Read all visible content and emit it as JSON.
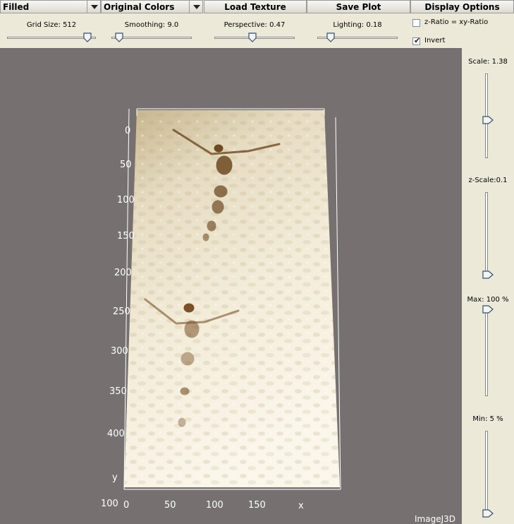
{
  "toolbar": {
    "render_mode": "Filled",
    "color_mode": "Original Colors",
    "load_texture": "Load Texture",
    "save_plot": "Save Plot",
    "display_options": "Display Options"
  },
  "sliders": {
    "grid_size": {
      "label": "Grid Size: 512",
      "level": 0.95
    },
    "smoothing": {
      "label": "Smoothing: 9.0",
      "level": 0.05
    },
    "perspective": {
      "label": "Perspective: 0.47",
      "level": 0.47
    },
    "lighting": {
      "label": "Lighting: 0.18",
      "level": 0.13
    }
  },
  "checkboxes": {
    "z_ratio": {
      "label": "z-Ratio = xy-Ratio",
      "checked": false
    },
    "invert": {
      "label": "Invert",
      "checked": true,
      "mark": "✔"
    }
  },
  "side_sliders": {
    "scale": {
      "label": "Scale: 1.38",
      "level": 0.45
    },
    "z_scale": {
      "label": "z-Scale:0.1",
      "level": 0.0
    },
    "max": {
      "label": "Max: 100 %",
      "level": 1.0
    },
    "min": {
      "label": "Min: 5 %",
      "level": 0.0
    }
  },
  "axes": {
    "y_ticks": [
      "0",
      "50",
      "100",
      "150",
      "200",
      "250",
      "300",
      "350",
      "400"
    ],
    "y_label": "y",
    "x_ticks": [
      "0",
      "50",
      "100",
      "150"
    ],
    "x_label": "x",
    "corner": "100"
  },
  "figures": {
    "top_label": "",
    "bottom_label": ""
  },
  "watermark": "ImageJ3D",
  "colors": {
    "background": "#767170",
    "panel": "#ece9d8",
    "surface_light": "#f2ead6",
    "surface_dark": "#c9b48a",
    "figure": "#6e4a22"
  }
}
